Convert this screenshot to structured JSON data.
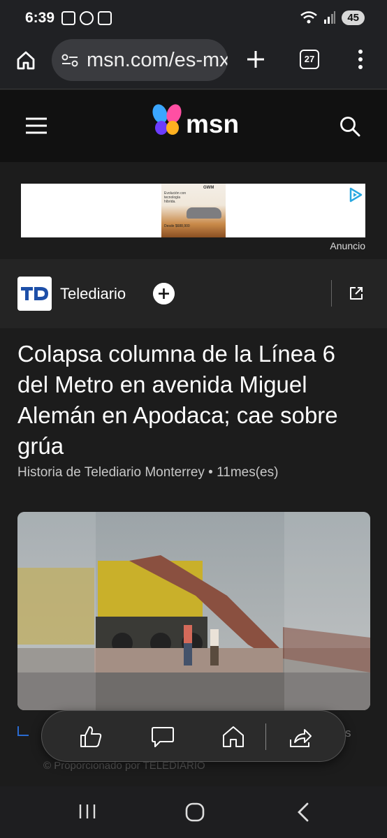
{
  "status_bar": {
    "time": "6:39",
    "battery": "45"
  },
  "browser": {
    "url": "msn.com/es-mx",
    "tab_count": "27"
  },
  "msn": {
    "brand": "msn"
  },
  "ad": {
    "label": "Anuncio",
    "brand": "GWM",
    "tagline": "Evolución con tecnología híbrida.",
    "price_text": "Desde $688,900"
  },
  "publisher": {
    "logo_text": "TD",
    "name": "Telediario"
  },
  "article": {
    "headline": "Colapsa columna de la Línea 6 del Metro en avenida Miguel Alemán en Apodaca; cae sobre grúa",
    "byline": "Historia de Telediario Monterrey • 11mes(es)",
    "credit": "© Proporcionado por TELEDIARIO"
  },
  "colors": {
    "accent_blue": "#2a6bd1",
    "background": "#1c1c1c",
    "header": "#111111"
  }
}
